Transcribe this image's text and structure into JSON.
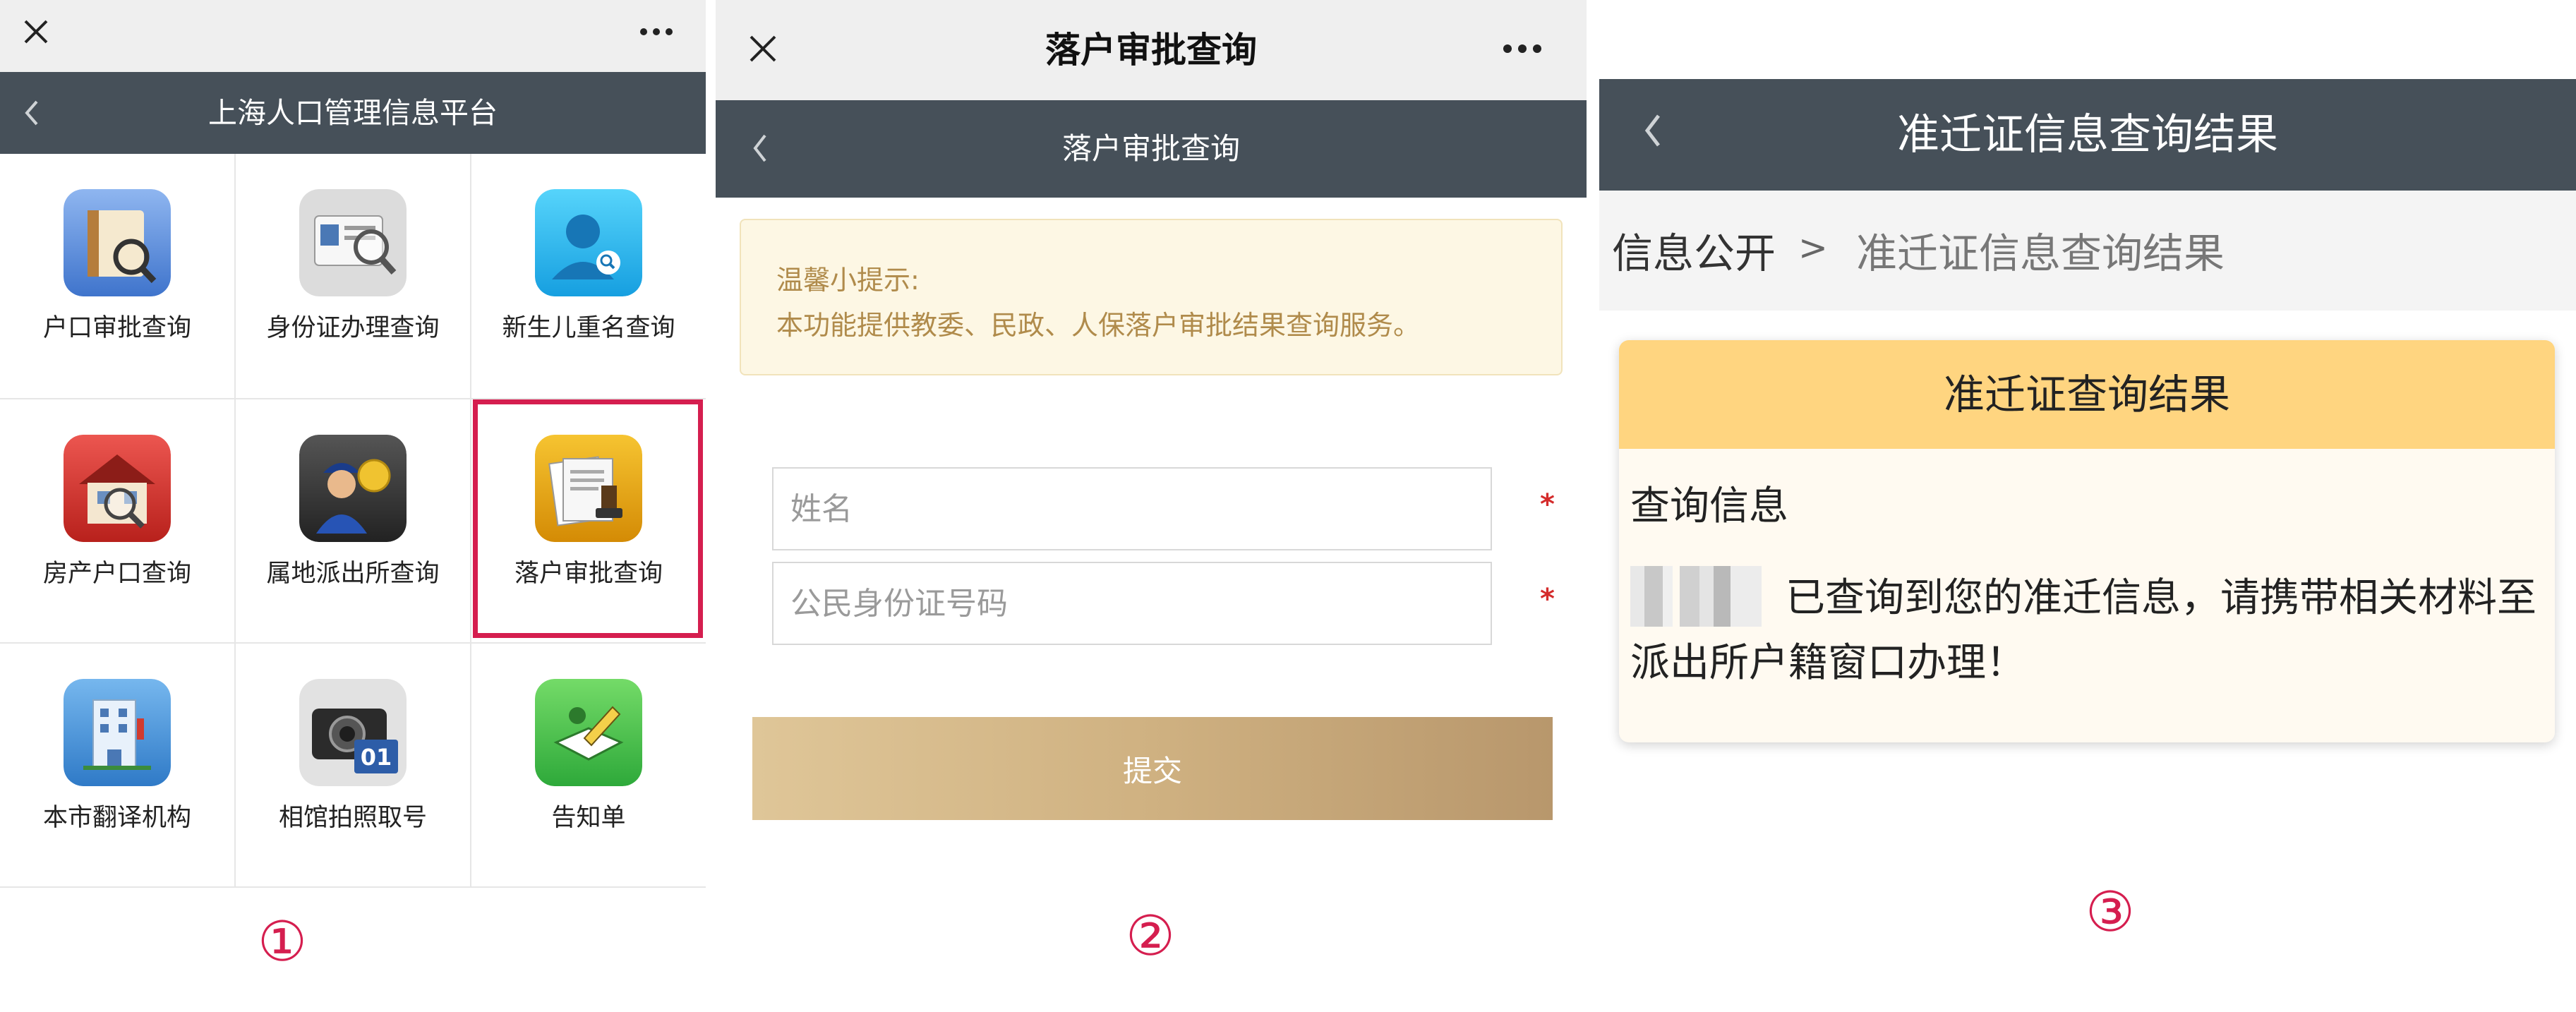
{
  "panel1": {
    "title": "上海人口管理信息平台",
    "grid": [
      {
        "label": "户口审批查询",
        "icon": "book-magnifier-icon",
        "color": "#4f86d8"
      },
      {
        "label": "身份证办理查询",
        "icon": "id-card-magnifier-icon",
        "color": "#d9d9d9"
      },
      {
        "label": "新生儿重名查询",
        "icon": "baby-search-icon",
        "color": "#27b6ee"
      },
      {
        "label": "房产户口查询",
        "icon": "house-magnifier-icon",
        "color": "#d8342e"
      },
      {
        "label": "属地派出所查询",
        "icon": "police-officer-icon",
        "color": "#333333"
      },
      {
        "label": "落户审批查询",
        "icon": "documents-stamp-icon",
        "color": "#e4a50c"
      },
      {
        "label": "本市翻译机构",
        "icon": "building-icon",
        "color": "#3f8fd4"
      },
      {
        "label": "相馆拍照取号",
        "icon": "camera-number-icon",
        "color": "#dcdcdc"
      },
      {
        "label": "告知单",
        "icon": "notice-pen-icon",
        "color": "#3bbf4a"
      }
    ],
    "highlight_color": "#d51e4f",
    "step_number": "①"
  },
  "panel2": {
    "window_title": "落户审批查询",
    "nav_title": "落户审批查询",
    "tip_title": "温馨小提示:",
    "tip_text": "本功能提供教委、民政、人保落户审批结果查询服务。",
    "name_placeholder": "姓名",
    "id_placeholder": "公民身份证号码",
    "required_mark": "*",
    "submit_label": "提交",
    "step_number": "②"
  },
  "panel3": {
    "nav_title": "准迁证信息查询结果",
    "breadcrumb_root": "信息公开",
    "breadcrumb_sep": ">",
    "breadcrumb_current": "准迁证信息查询结果",
    "card_title": "准迁证查询结果",
    "card_subtitle": "查询信息",
    "card_message": "已查询到您的准迁信息，请携带相关材料至派出所户籍窗口办理！",
    "step_number": "③"
  }
}
